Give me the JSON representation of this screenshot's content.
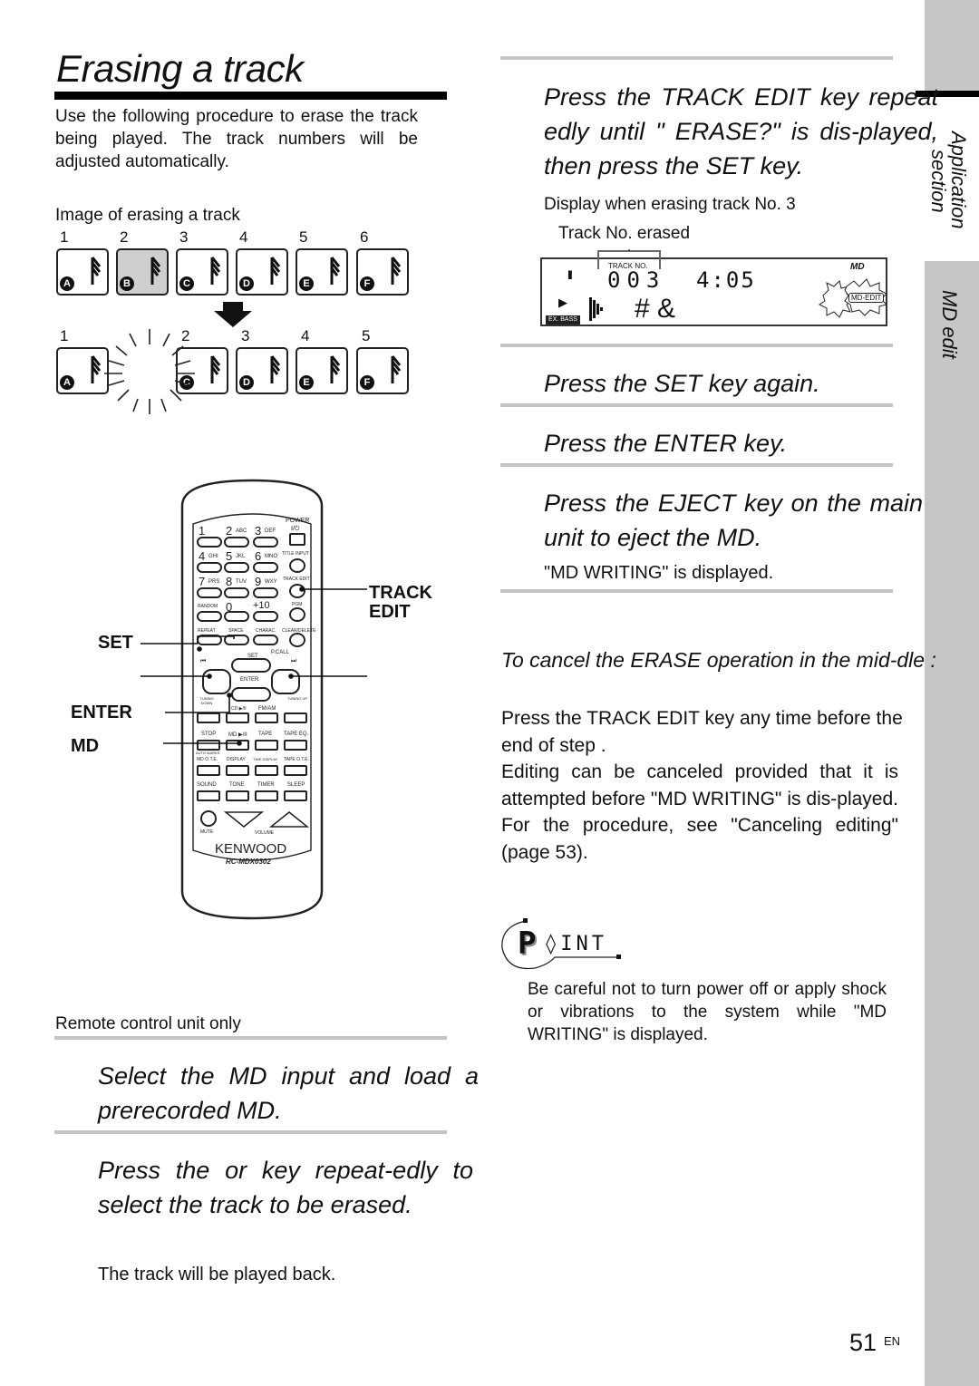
{
  "page": {
    "title": "Erasing a track",
    "intro": "Use the following procedure to erase the track being played. The track numbers will be adjusted automatically.",
    "image_caption": "Image of erasing a track",
    "page_number": "51",
    "page_lang": "EN",
    "side_tab_section": "Application section",
    "side_tab_section_line1": "Application",
    "side_tab_section_line2": "section",
    "side_tab_topic": "MD edit"
  },
  "diagram": {
    "before": [
      {
        "num": "1",
        "letter": "A",
        "selected": false
      },
      {
        "num": "2",
        "letter": "B",
        "selected": true
      },
      {
        "num": "3",
        "letter": "C",
        "selected": false
      },
      {
        "num": "4",
        "letter": "D",
        "selected": false
      },
      {
        "num": "5",
        "letter": "E",
        "selected": false
      },
      {
        "num": "6",
        "letter": "F",
        "selected": false
      }
    ],
    "after": [
      {
        "num": "1",
        "letter": "A"
      },
      {
        "num": "2",
        "letter": "C"
      },
      {
        "num": "3",
        "letter": "D"
      },
      {
        "num": "4",
        "letter": "E"
      },
      {
        "num": "5",
        "letter": "F"
      }
    ]
  },
  "remote": {
    "caption": "Remote control unit only",
    "brand": "KENWOOD",
    "model": "RC-MDX0302",
    "callouts": {
      "track_edit_1": "TRACK",
      "track_edit_2": "EDIT",
      "set": "SET",
      "enter": "ENTER",
      "md": "MD"
    },
    "keys": {
      "power": "POWER",
      "power_sym": "I/⏻",
      "k1": "1",
      "k2": "2",
      "k3": "3",
      "k4": "4",
      "k5": "5",
      "k6": "6",
      "k7": "7",
      "k8": "8",
      "k9": "9",
      "k0": "0",
      "k10": "+10",
      "k2s": "ABC",
      "k3s": "DEF",
      "k4s": "GHI",
      "k5s": "JKL",
      "k6s": "MNO",
      "k7s": "PRS",
      "k8s": "TUV",
      "k9s": "WXY",
      "title_input": "TITLE INPUT",
      "track_edit": "TRACK EDIT",
      "random": "RANDOM",
      "pgm": "PGM",
      "repeat": "REPEAT",
      "space": "SPACE",
      "charac": "CHARAC.",
      "clear_delete": "CLEAR/DELETE",
      "set": "SET",
      "pcall": "P.CALL",
      "enter": "ENTER",
      "prev": "⏮",
      "next": "⏭",
      "tuning_down": "TUNING DOWN",
      "tuning_up": "TUNING UP",
      "cd": "CD ▶/II",
      "fm_am": "FM/AM",
      "stop": "STOP",
      "md_play": "MD ▶/II",
      "tape": "TAPE",
      "tape_eq": "TAPE EQ.",
      "auto_marks": "AUTO MARKS",
      "md_ote": "MD O.T.E.",
      "display": "DISPLAY",
      "time_display": "TIME DISPLAY",
      "tape_ote": "TAPE O.T.E.",
      "sound": "SOUND",
      "tone": "TONE",
      "timer": "TIMER",
      "sleep": "SLEEP",
      "mute": "MUTE",
      "volume": "VOLUME"
    }
  },
  "steps": {
    "s1": "Select the MD input and load a prerecorded MD.",
    "s2": "Press the       or       key repeat-edly to select the track to be erased.",
    "s2_note": "The track will be played back.",
    "s3": "Press the TRACK EDIT key repeat edly until \"   ERASE?\" is dis-played, then press the SET key.",
    "s3_caption": "Display when erasing track No. 3",
    "s3_callout": "Track No. erased",
    "s4": "Press the SET key again.",
    "s5": "Press the ENTER key.",
    "s6": "Press the  EJECT key on the main unit to eject the MD.",
    "s6_note": "\"MD WRITING\" is displayed."
  },
  "display": {
    "track_label": "TRACK NO.",
    "track_no": "003",
    "time": "4:05",
    "symbols": "# &",
    "md_logo": "MD",
    "md_edit": "MD-EDIT",
    "ex_bass": "EX. BASS",
    "pause": "II",
    "play": "▶"
  },
  "cancel": {
    "heading": "To cancel the ERASE operation in the mid-dle :",
    "p1": "Press the TRACK EDIT key any time before the end of step     .",
    "p2": "Editing can be canceled provided that it is attempted before \"MD WRITING\" is dis-played. For the procedure, see \"Canceling editing\" (page 53)."
  },
  "point": {
    "label_p": "P",
    "label_rest": "◊INT",
    "text": "Be careful not to turn power off or apply shock or vibrations to the system while \"MD WRITING\" is displayed."
  }
}
